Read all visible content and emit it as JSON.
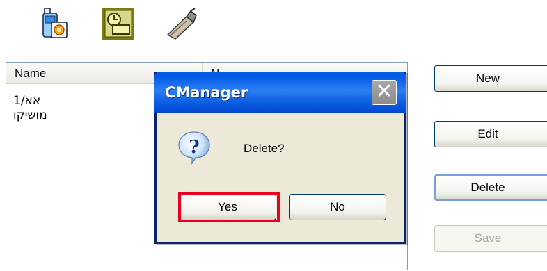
{
  "toolbar": {
    "icons": [
      "phone-settings-icon",
      "clock-card-icon",
      "data-cable-icon"
    ]
  },
  "list": {
    "columns": [
      "Name",
      "N"
    ],
    "rows": [
      "אא/1",
      "מושיקו"
    ]
  },
  "buttons": {
    "new": "New",
    "edit": "Edit",
    "delete": "Delete",
    "save": "Save"
  },
  "dialog": {
    "title": "CManager",
    "close_glyph": "✕",
    "icon": "question-icon",
    "message": "Delete?",
    "yes": "Yes",
    "no": "No"
  },
  "colors": {
    "title_bar": "#0a5ee0",
    "highlight": "#e8001c",
    "dialog_bg": "#ece9d8"
  }
}
